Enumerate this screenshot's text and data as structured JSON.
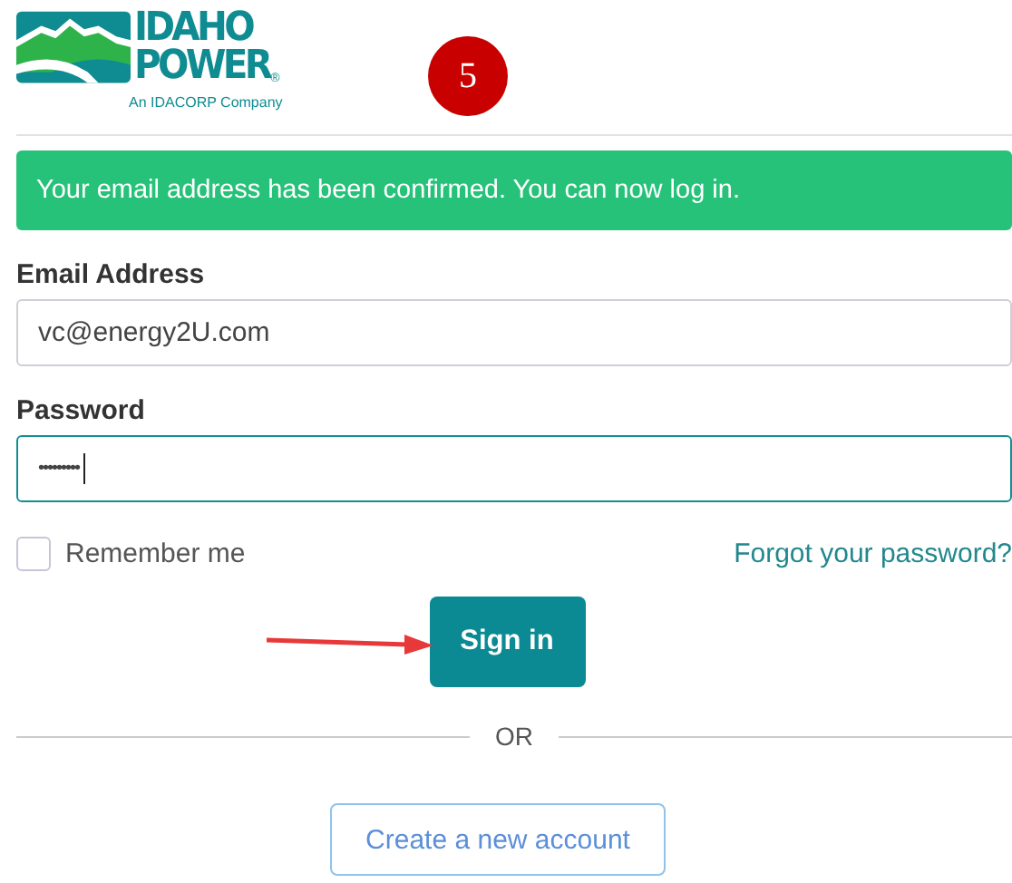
{
  "logo": {
    "line1": "IDAHO",
    "line2": "POWER",
    "mark": "®",
    "tagline": "An IDACORP Company"
  },
  "step_badge": "5",
  "alert": "Your email address has been confirmed. You can now log in.",
  "fields": [
    {
      "label": "Email Address",
      "value": "vc@energy2U.com",
      "focused": false
    },
    {
      "label": "Password",
      "value": "•••••••••",
      "focused": true
    }
  ],
  "remember_me": {
    "label": "Remember me",
    "checked": false
  },
  "forgot_link": "Forgot your password?",
  "sign_in_button": "Sign in",
  "divider_text": "OR",
  "create_account_button": "Create a new account"
}
